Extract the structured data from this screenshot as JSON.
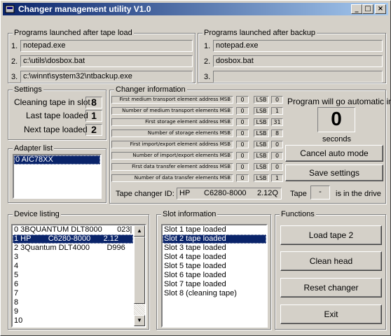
{
  "window": {
    "title": "Changer management utility V1.0",
    "min": "_",
    "max": "□",
    "close": "×"
  },
  "load": {
    "legend": "Programs launched after tape load",
    "rows": [
      {
        "n": "1.",
        "v": "notepad.exe"
      },
      {
        "n": "2.",
        "v": "c:\\utils\\dosbox.bat"
      },
      {
        "n": "3.",
        "v": "c:\\winnt\\system32\\ntbackup.exe"
      }
    ]
  },
  "backup": {
    "legend": "Programs launched after backup",
    "rows": [
      {
        "n": "1.",
        "v": "notepad.exe"
      },
      {
        "n": "2.",
        "v": "dosbox.bat"
      },
      {
        "n": "3.",
        "v": ""
      }
    ]
  },
  "settings": {
    "legend": "Settings",
    "cleaning_label": "Cleaning tape in slot",
    "cleaning": "8",
    "last_label": "Last tape loaded",
    "last": "1",
    "next_label": "Next tape loaded",
    "next": "2"
  },
  "adapter": {
    "legend": "Adapter list",
    "items": [
      "0 AIC78XX"
    ]
  },
  "changer": {
    "legend": "Changer information",
    "lsb": "LSB",
    "rows": [
      {
        "label": "First medium transport element address MSB",
        "msb": "0",
        "lsb": "0"
      },
      {
        "label": "Number of medium transport elements MSB",
        "msb": "0",
        "lsb": "1"
      },
      {
        "label": "First storage element address MSB",
        "msb": "0",
        "lsb": "31"
      },
      {
        "label": "Number of storage elements MSB",
        "msb": "0",
        "lsb": "8"
      },
      {
        "label": "First import/export element address MSB",
        "msb": "0",
        "lsb": "0"
      },
      {
        "label": "Number of import/export elements MSB",
        "msb": "0",
        "lsb": "0"
      },
      {
        "label": "First data transfer element address MSB",
        "msb": "0",
        "lsb": "0"
      },
      {
        "label": "Number of data transfer elements MSB",
        "msb": "0",
        "lsb": "1"
      }
    ],
    "id_label": "Tape changer ID:",
    "id_vendor": "HP",
    "id_model": "C6280-8000",
    "id_rev": "2.12Q",
    "tape_label": "Tape",
    "tape_val": "-",
    "drive_text": "is in the drive"
  },
  "auto": {
    "label": "Program will go automatic in",
    "count": "0",
    "unit": "seconds",
    "cancel": "Cancel auto mode",
    "save": "Save settings"
  },
  "devices": {
    "legend": "Device listing",
    "items": [
      "0 3BQUANTUM DLT8000       023|",
      "1 HP        C6280-8000      2.12",
      "2 3Quantum DLT4000        D996",
      "3",
      "4",
      "5",
      "6",
      "7",
      "8",
      "9",
      "10"
    ],
    "selected": 1
  },
  "slots": {
    "legend": "Slot information",
    "items": [
      "Slot 1 tape loaded",
      "Slot 2 tape loaded",
      "Slot 3 tape loaded",
      "Slot 4 tape loaded",
      "Slot 5 tape loaded",
      "Slot 6 tape loaded",
      "Slot 7 tape loaded",
      "Slot 8 (cleaning tape)"
    ],
    "selected": 1
  },
  "functions": {
    "legend": "Functions",
    "load": "Load tape 2",
    "clean": "Clean head",
    "reset": "Reset changer",
    "exit": "Exit"
  }
}
